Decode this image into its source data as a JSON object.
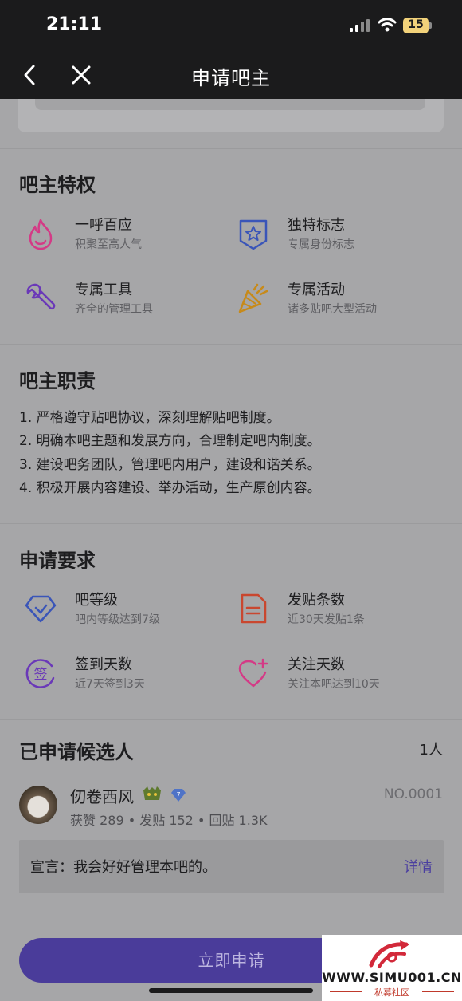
{
  "status_bar": {
    "time": "21:11",
    "battery": "15"
  },
  "nav": {
    "title": "申请吧主"
  },
  "privileges": {
    "heading": "吧主特权",
    "items": [
      {
        "title": "一呼百应",
        "subtitle": "积聚至高人气",
        "icon": "flame-icon",
        "color": "#d43a86"
      },
      {
        "title": "独特标志",
        "subtitle": "专属身份标志",
        "icon": "star-badge-icon",
        "color": "#3a55b8"
      },
      {
        "title": "专属工具",
        "subtitle": "齐全的管理工具",
        "icon": "wrench-icon",
        "color": "#6a38b8"
      },
      {
        "title": "专属活动",
        "subtitle": "诸多贴吧大型活动",
        "icon": "party-popper-icon",
        "color": "#c78a1a"
      }
    ]
  },
  "duties": {
    "heading": "吧主职责",
    "lines": [
      "1. 严格遵守贴吧协议，深刻理解贴吧制度。",
      "2. 明确本吧主题和发展方向，合理制定吧内制度。",
      "3. 建设吧务团队，管理吧内用户，建设和谐关系。",
      "4. 积极开展内容建设、举办活动，生产原创内容。"
    ]
  },
  "requirements": {
    "heading": "申请要求",
    "items": [
      {
        "title": "吧等级",
        "subtitle": "吧内等级达到7级",
        "icon": "level-diamond-icon",
        "color": "#3a55b8"
      },
      {
        "title": "发贴条数",
        "subtitle": "近30天发贴1条",
        "icon": "document-icon",
        "color": "#c9472f"
      },
      {
        "title": "签到天数",
        "subtitle": "近7天签到3天",
        "icon": "sign-in-icon",
        "color": "#6a38b8"
      },
      {
        "title": "关注天数",
        "subtitle": "关注本吧达到10天",
        "icon": "heart-plus-icon",
        "color": "#d43a86"
      }
    ]
  },
  "candidates": {
    "heading": "已申请候选人",
    "count": "1人",
    "list": [
      {
        "name": "仞卷西风",
        "number": "NO.0001",
        "stats": "获赞 289 • 发贴 152 • 回贴 1.3K",
        "declaration": "宣言：我会好好管理本吧的。",
        "detail_label": "详情"
      }
    ]
  },
  "apply_button": {
    "label": "立即申请"
  },
  "watermark": {
    "url": "WWW.SIMU001.CN",
    "sub": "私募社区"
  }
}
